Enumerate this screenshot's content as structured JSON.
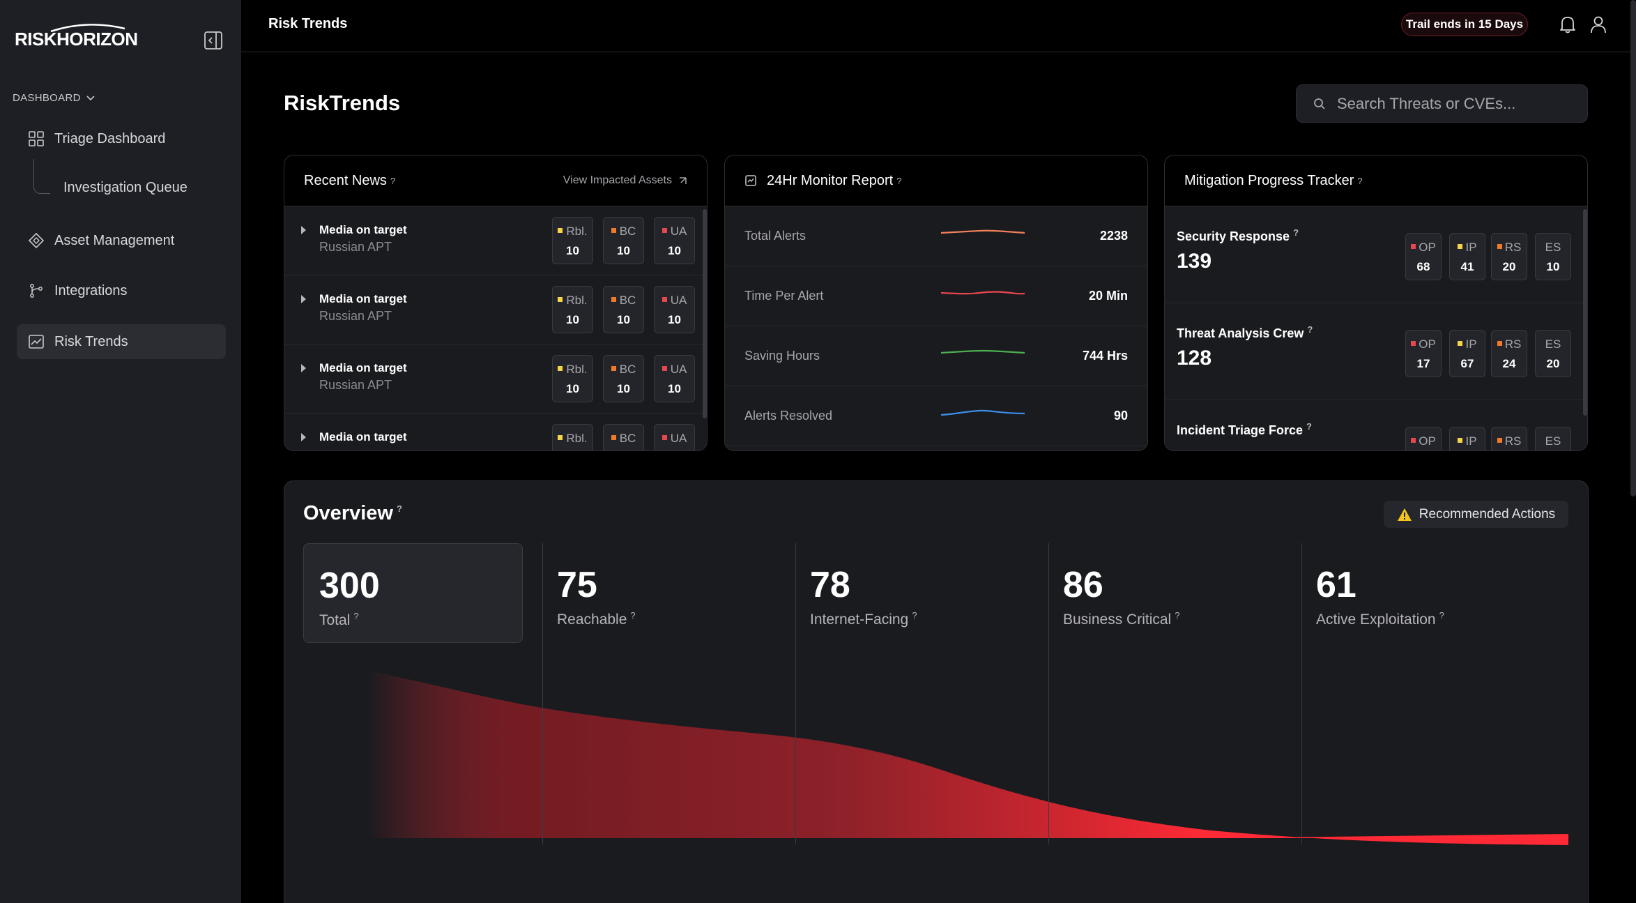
{
  "app": {
    "logo_text": "RISKHORIZON",
    "section_label": "DASHBOARD",
    "nav": [
      {
        "label": "Triage Dashboard",
        "icon": "grid-icon"
      },
      {
        "label": "Investigation Queue"
      },
      {
        "label": "Asset Management",
        "icon": "diamond-icon"
      },
      {
        "label": "Integrations",
        "icon": "branch-icon"
      },
      {
        "label": "Risk Trends",
        "icon": "chart-icon",
        "active": true
      }
    ]
  },
  "topbar": {
    "title": "Risk Trends",
    "trial_badge": "Trail ends in 15 Days"
  },
  "page": {
    "title": "RiskTrends",
    "search_placeholder": "Search Threats or CVEs..."
  },
  "news": {
    "title": "Recent News",
    "help": "?",
    "view_link": "View Impacted Assets",
    "rows": [
      {
        "title": "Media on target",
        "sub": "Russian APT",
        "tags": [
          {
            "label": "Rbl.",
            "value": "10"
          },
          {
            "label": "BC",
            "value": "10"
          },
          {
            "label": "UA",
            "value": "10"
          }
        ]
      },
      {
        "title": "Media on target",
        "sub": "Russian APT",
        "tags": [
          {
            "label": "Rbl.",
            "value": "10"
          },
          {
            "label": "BC",
            "value": "10"
          },
          {
            "label": "UA",
            "value": "10"
          }
        ]
      },
      {
        "title": "Media on target",
        "sub": "Russian APT",
        "tags": [
          {
            "label": "Rbl.",
            "value": "10"
          },
          {
            "label": "BC",
            "value": "10"
          },
          {
            "label": "UA",
            "value": "10"
          }
        ]
      },
      {
        "title": "Media on target",
        "sub": "",
        "tags": [
          {
            "label": "Rbl.",
            "value": ""
          },
          {
            "label": "BC",
            "value": ""
          },
          {
            "label": "UA",
            "value": ""
          }
        ]
      }
    ]
  },
  "monitor": {
    "title": "24Hr Monitor Report",
    "help": "?",
    "rows": [
      {
        "label": "Total Alerts",
        "value": "2238",
        "color": "#f0805a"
      },
      {
        "label": "Time Per Alert",
        "value": "20 Min",
        "color": "#e8474e"
      },
      {
        "label": "Saving Hours",
        "value": "744 Hrs",
        "color": "#4caf50"
      },
      {
        "label": "Alerts Resolved",
        "value": "90",
        "color": "#3b8fe8"
      }
    ]
  },
  "mitigation": {
    "title": "Mitigation Progress Tracker",
    "help": "?",
    "rows": [
      {
        "name": "Security Response",
        "total": "139",
        "tags": [
          {
            "label": "OP",
            "value": "68"
          },
          {
            "label": "IP",
            "value": "41"
          },
          {
            "label": "RS",
            "value": "20"
          },
          {
            "label": "ES",
            "value": "10"
          }
        ]
      },
      {
        "name": "Threat Analysis Crew",
        "total": "128",
        "tags": [
          {
            "label": "OP",
            "value": "17"
          },
          {
            "label": "IP",
            "value": "67"
          },
          {
            "label": "RS",
            "value": "24"
          },
          {
            "label": "ES",
            "value": "20"
          }
        ]
      },
      {
        "name": "Incident Triage Force",
        "total": "",
        "tags": [
          {
            "label": "OP",
            "value": ""
          },
          {
            "label": "IP",
            "value": ""
          },
          {
            "label": "RS",
            "value": ""
          },
          {
            "label": "ES",
            "value": ""
          }
        ]
      }
    ]
  },
  "overview": {
    "title": "Overview",
    "help": "?",
    "recommended": "Recommended Actions",
    "stats": [
      {
        "value": "300",
        "label": "Total"
      },
      {
        "value": "75",
        "label": "Reachable"
      },
      {
        "value": "78",
        "label": "Internet-Facing"
      },
      {
        "value": "86",
        "label": "Business Critical"
      },
      {
        "value": "61",
        "label": "Active Exploitation"
      }
    ]
  },
  "colors": {
    "tag_rbl": "#f5d547",
    "tag_bc": "#f07a2a",
    "tag_ua": "#e5484d",
    "tag_op": "#e5484d",
    "tag_ip": "#f5d547",
    "tag_rs": "#f07a2a",
    "funnel": "#ff2a35"
  }
}
